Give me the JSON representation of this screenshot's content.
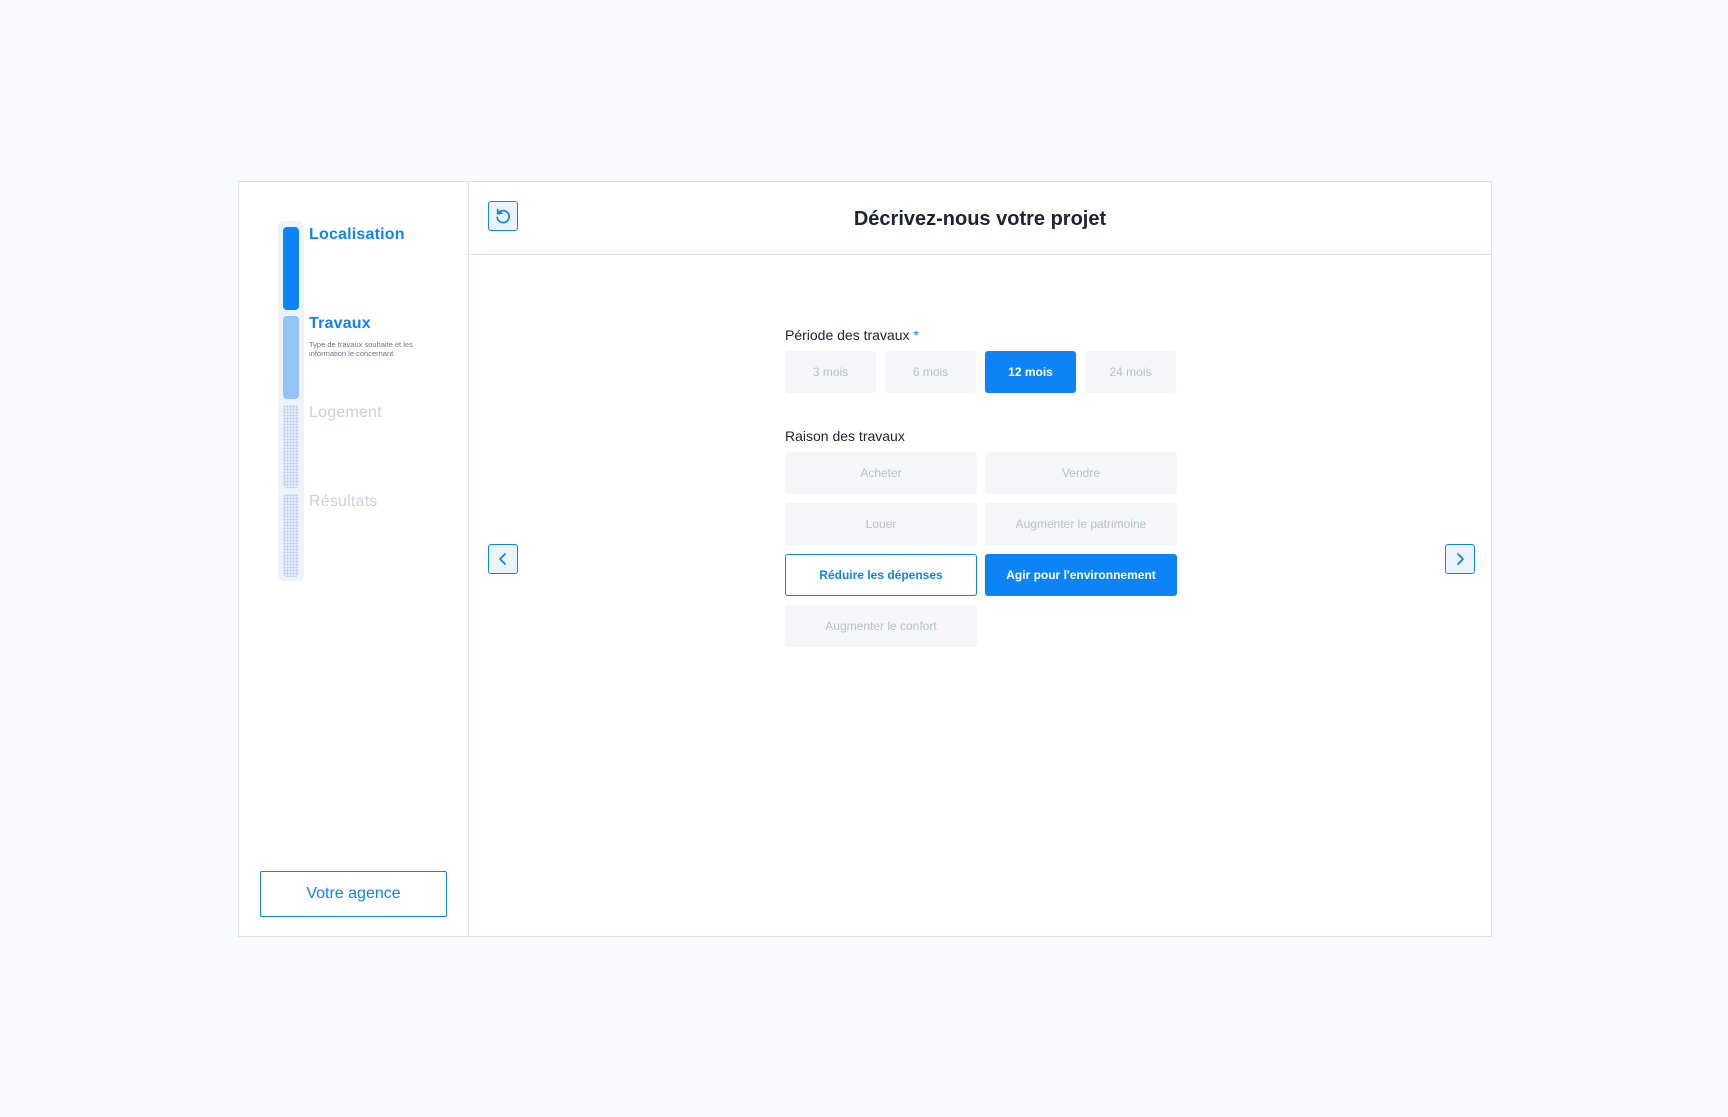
{
  "sidebar": {
    "steps": [
      {
        "label": "Localisation",
        "description": "",
        "state": "done"
      },
      {
        "label": "Travaux",
        "description": "Type de travaux souhaite et les information le concernant",
        "state": "current"
      },
      {
        "label": "Logement",
        "description": "",
        "state": "todo"
      },
      {
        "label": "Résultats",
        "description": "",
        "state": "todo"
      }
    ],
    "agency_label": "Votre agence"
  },
  "header": {
    "title": "Décrivez-nous votre projet",
    "reset_icon": "refresh-icon"
  },
  "navigation": {
    "prev_icon": "chevron-left-icon",
    "next_icon": "chevron-right-icon"
  },
  "period": {
    "label": "Période des travaux",
    "required_mark": "*",
    "options": [
      "3 mois",
      "6 mois",
      "12 mois",
      "24 mois"
    ],
    "selected": "12 mois"
  },
  "reason": {
    "label": "Raison des travaux",
    "options": [
      "Acheter",
      "Vendre",
      "Louer",
      "Augmenter le patrimoine",
      "Réduire les dépenses",
      "Agir pour l'environnement",
      "Augmenter le confort"
    ],
    "selected": [
      "Réduire les dépenses",
      "Agir pour l'environnement"
    ]
  },
  "colors": {
    "accent": "#0d84f5",
    "accent_light": "#92c4f5",
    "muted_text": "#b8c2ce",
    "chip_bg": "#f4f6f9",
    "page_bg": "#f8fafd"
  }
}
